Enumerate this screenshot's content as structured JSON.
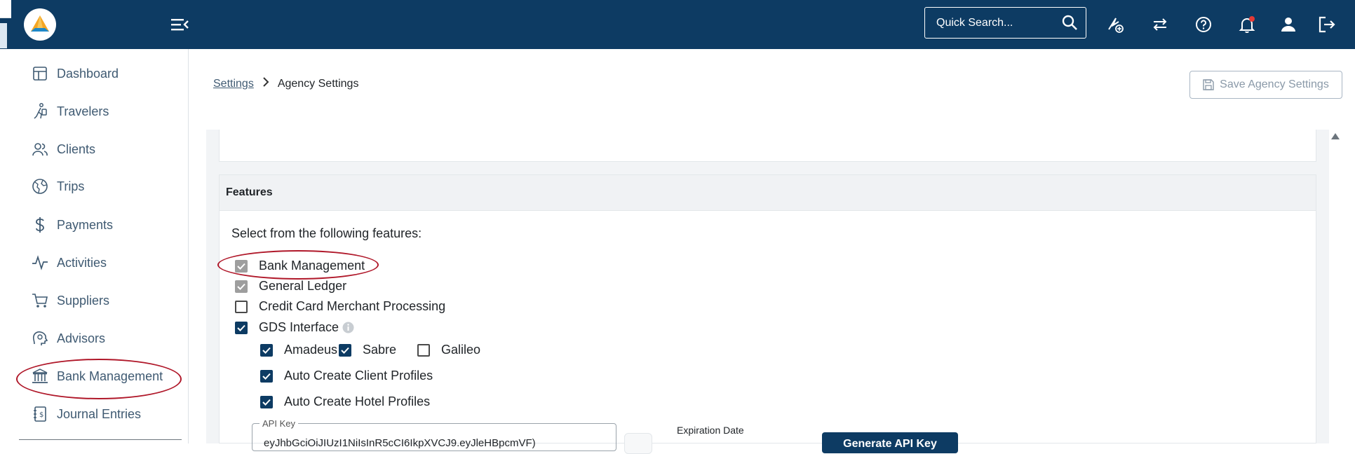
{
  "topbar": {
    "search_placeholder": "Quick Search...",
    "icons": [
      "quick-add-icon",
      "swap-icon",
      "help-icon",
      "notification-bell-icon",
      "user-icon",
      "logout-icon"
    ]
  },
  "sidebar": {
    "items": [
      {
        "label": "Dashboard",
        "icon": "dashboard-icon"
      },
      {
        "label": "Travelers",
        "icon": "traveler-icon"
      },
      {
        "label": "Clients",
        "icon": "clients-icon"
      },
      {
        "label": "Trips",
        "icon": "globe-icon"
      },
      {
        "label": "Payments",
        "icon": "dollar-icon"
      },
      {
        "label": "Activities",
        "icon": "activity-icon"
      },
      {
        "label": "Suppliers",
        "icon": "cart-icon"
      },
      {
        "label": "Advisors",
        "icon": "advisor-icon"
      },
      {
        "label": "Bank Management",
        "icon": "bank-icon"
      },
      {
        "label": "Journal Entries",
        "icon": "journal-icon"
      }
    ]
  },
  "breadcrumb": {
    "parent": "Settings",
    "current": "Agency Settings"
  },
  "actions": {
    "save_label": "Save Agency Settings"
  },
  "features": {
    "title": "Features",
    "intro": "Select from the following features:",
    "options": {
      "bank_management": "Bank Management",
      "general_ledger": "General Ledger",
      "credit_card": "Credit Card Merchant Processing",
      "gds_interface": "GDS Interface"
    },
    "gds": {
      "amadeus": "Amadeus",
      "sabre": "Sabre",
      "galileo": "Galileo",
      "auto_client": "Auto Create Client Profiles",
      "auto_hotel": "Auto Create Hotel Profiles"
    },
    "api_key_label": "API Key",
    "api_key_value": "eyJhbGciOiJIUzI1NiIsInR5cCI6IkpXVCJ9.eyJleHBpcmVF)",
    "expiration_label": "Expiration Date",
    "generate_label": "Generate API Key"
  },
  "colors": {
    "brand": "#0d3b63",
    "highlight": "#b0182a"
  }
}
